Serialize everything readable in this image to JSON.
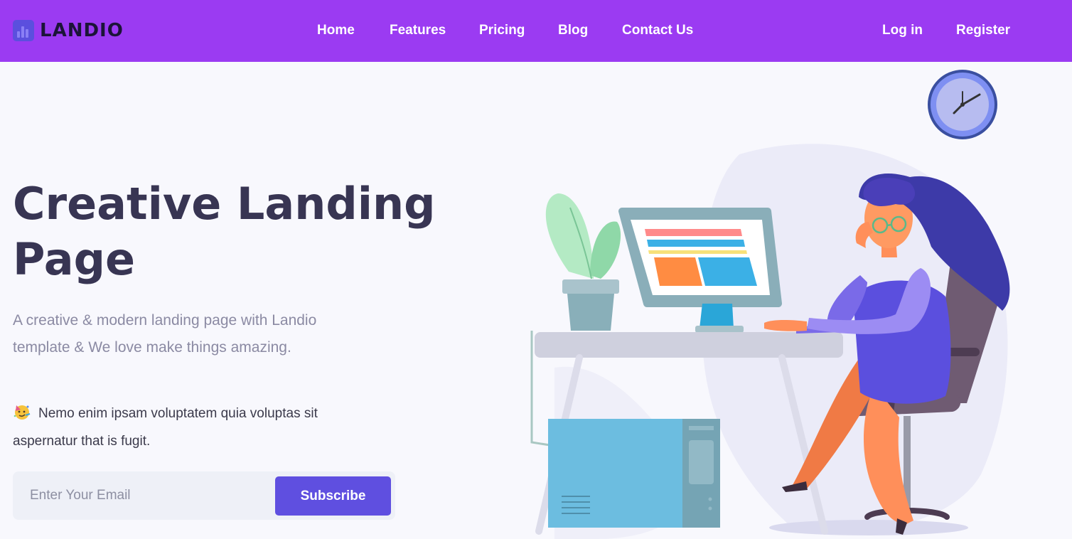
{
  "brand": {
    "name": "LANDIO"
  },
  "nav": {
    "links": [
      "Home",
      "Features",
      "Pricing",
      "Blog",
      "Contact Us"
    ],
    "login": "Log in",
    "register": "Register"
  },
  "hero": {
    "title_line1": "Creative Landing",
    "title_line2": "Page",
    "subtitle": "A creative & modern landing page with Landio template & We love make things amazing.",
    "note": "Nemo enim ipsam voluptatem quia voluptas sit aspernatur that is fugit."
  },
  "subscribe": {
    "placeholder": "Enter Your Email",
    "button": "Subscribe"
  },
  "colors": {
    "header_bg": "#9b3bf2",
    "accent": "#5f4fe0",
    "heading": "#383553",
    "page_bg": "#f8f8fd"
  },
  "icons": {
    "logo": "bar-chart-logo-icon",
    "note": "party-face-emoji-icon"
  }
}
